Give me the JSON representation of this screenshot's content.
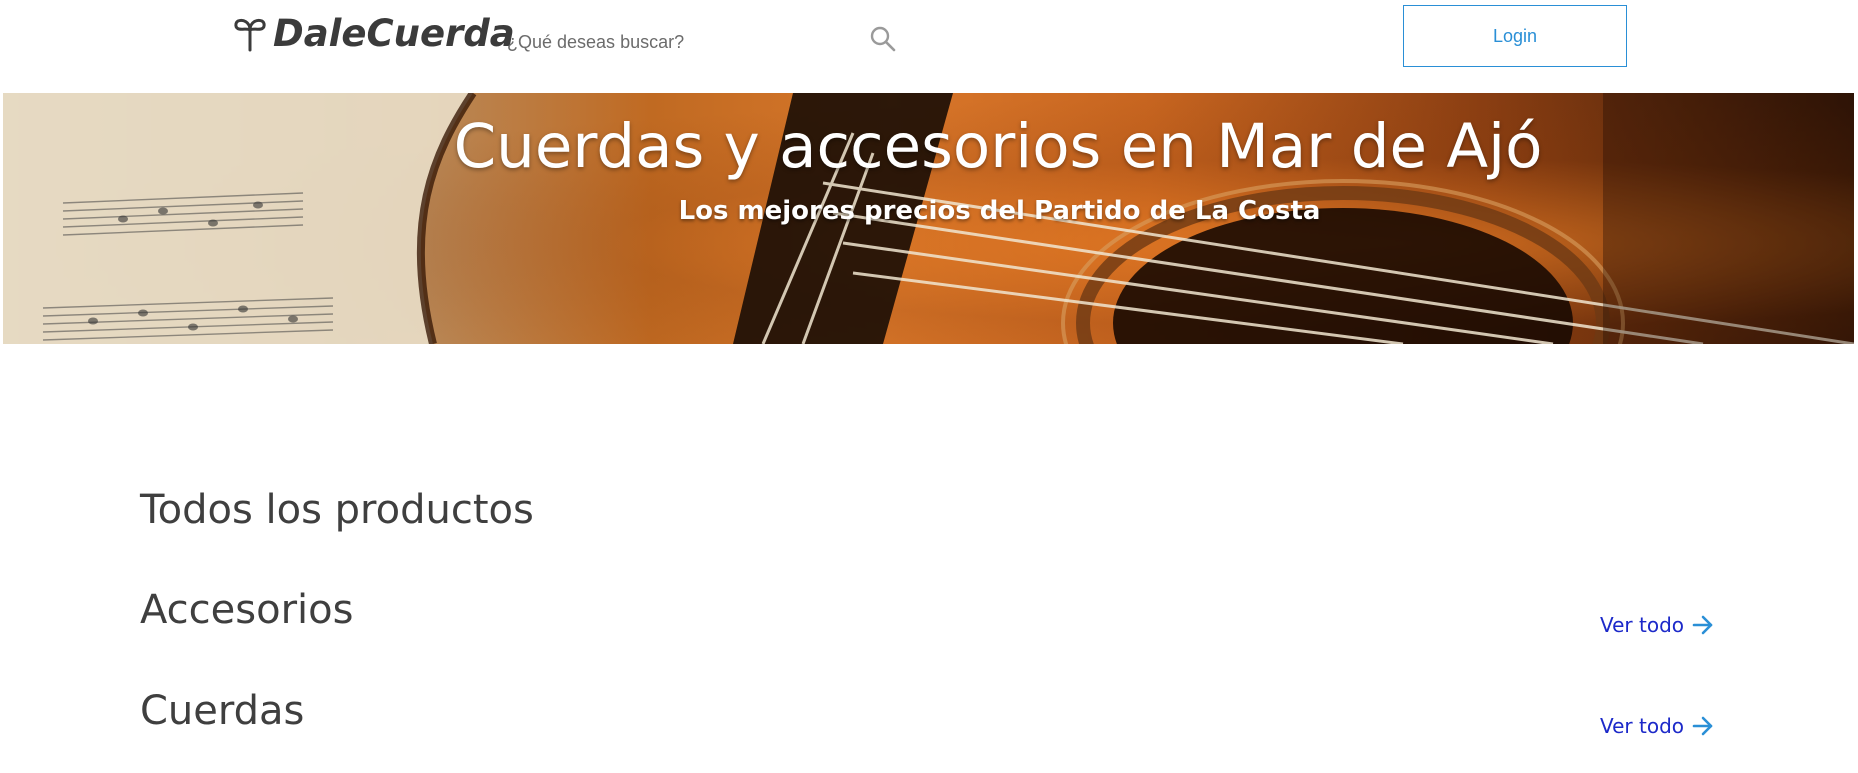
{
  "header": {
    "logo_text": "DaleCuerda",
    "search_placeholder": "¿Qué deseas buscar?",
    "login_label": "Login"
  },
  "hero": {
    "title": "Cuerdas y accesorios en Mar de Ajó",
    "subtitle": "Los mejores precios del Partido de La Costa"
  },
  "main": {
    "all_products_title": "Todos los productos",
    "categories": [
      {
        "title": "Accesorios",
        "link_label": "Ver todo"
      },
      {
        "title": "Cuerdas",
        "link_label": "Ver todo"
      }
    ]
  },
  "colors": {
    "accent_blue": "#2a8fd6",
    "link_blue": "#1c29c9",
    "arrow_blue": "#2a8fd6",
    "text_dark": "#3f3f3f"
  },
  "icons": [
    "logo-sprout-icon",
    "search-icon",
    "arrow-right-icon"
  ]
}
